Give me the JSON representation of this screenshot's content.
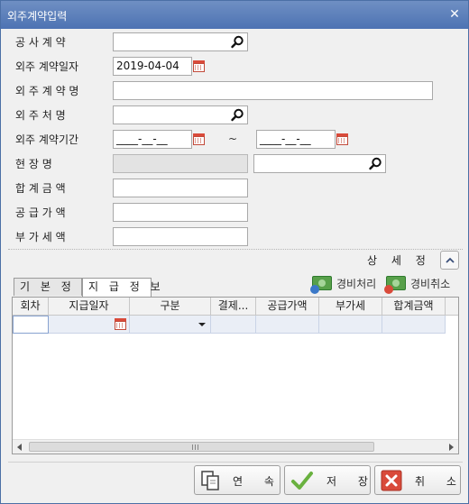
{
  "window": {
    "title": "외주계약입력",
    "close_glyph": "✕"
  },
  "form": {
    "contract_label": "공 사 계 약",
    "outsource_date_label": "외주 계약일자",
    "outsource_date_value": "2019-04-04",
    "outsource_name_label": "외 주 계 약 명",
    "vendor_label": "외 주 처 명",
    "period_label": "외주 계약기간",
    "period_from": "____-__-__",
    "period_tilde": "~",
    "period_to": "____-__-__",
    "site_label": "현 장 명",
    "total_label": "합 계 금 액",
    "supply_label": "공 급 가 액",
    "vat_label": "부 가 세 액"
  },
  "detail": {
    "label": "상 세 정 보"
  },
  "tabs": [
    {
      "label": "기 본 정 보"
    },
    {
      "label": "지 급 정 보"
    }
  ],
  "actions": {
    "expense_process": "경비처리",
    "expense_cancel": "경비취소"
  },
  "grid": {
    "columns": [
      "회차",
      "지급일자",
      "구분",
      "결제...",
      "공급가액",
      "부가세",
      "합계금액"
    ]
  },
  "scrollbar": {
    "grip": "|||"
  },
  "footer": {
    "continue": "연 속",
    "save": "저 장",
    "cancel": "취 소"
  },
  "colors": {
    "title_bar": "#5a7dba",
    "accent_red": "#d94a3a",
    "check_green": "#69b13f"
  }
}
